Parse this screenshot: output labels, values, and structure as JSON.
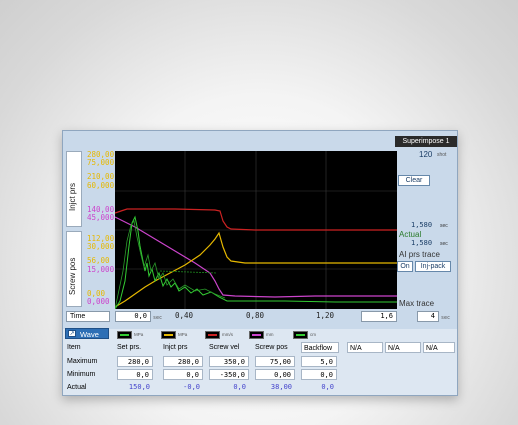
{
  "header": {
    "superimpose_label": "Superimpose 1",
    "shot_count": "120",
    "shot_unit": "shot"
  },
  "left_axes": {
    "upper_label": "Injct prs",
    "lower_label": "Screw pos",
    "upper_ticks": [
      {
        "text": "280,00",
        "color": "#e6b800"
      },
      {
        "text": "75,000",
        "color": "#e6b800"
      },
      {
        "text": "210,00",
        "color": "#e6b800"
      },
      {
        "text": "60,000",
        "color": "#e6b800"
      },
      {
        "text": "140,00",
        "color": "#cc44cc"
      },
      {
        "text": "45,000",
        "color": "#cc44cc"
      }
    ],
    "lower_ticks": [
      {
        "text": "112,00",
        "color": "#e6b800"
      },
      {
        "text": "30,000",
        "color": "#e6b800"
      },
      {
        "text": "56,00",
        "color": "#e6b800"
      },
      {
        "text": "15,000",
        "color": "#cc44cc"
      },
      {
        "text": "0,00",
        "color": "#e6b800"
      },
      {
        "text": "0,000",
        "color": "#cc44cc"
      }
    ]
  },
  "right_panel": {
    "clear_label": "Clear",
    "time1_value": "1,580",
    "time1_unit": "sec",
    "actual_label": "Actual",
    "time2_value": "1,580",
    "time2_unit": "sec",
    "ai_trace_label": "AI prs trace",
    "on_label": "On",
    "mode_label": "Inj-pack",
    "max_trace_label": "Max trace",
    "max_trace_value": "4",
    "max_trace_unit": "sec"
  },
  "time_axis": {
    "label": "Time",
    "start_value": "0,0",
    "unit": "sec",
    "ticks": [
      "0,40",
      "0,80",
      "1,20"
    ],
    "end_value": "1,6"
  },
  "wave_tab": {
    "label": "Wave"
  },
  "legend": [
    {
      "unit": "MPa",
      "color": "#33cc33"
    },
    {
      "unit": "MPa",
      "color": "#e6b800"
    },
    {
      "unit": "mm/s",
      "color": "#cc2222"
    },
    {
      "unit": "mm",
      "color": "#cc44cc"
    },
    {
      "unit": "cm",
      "color": "#33cc33"
    }
  ],
  "table": {
    "headers": [
      "Item",
      "Set prs.",
      "Injct prs",
      "Screw vel",
      "Screw pos",
      "Backflow",
      "N/A",
      "N/A",
      "N/A"
    ],
    "rows": [
      {
        "label": "Maximum",
        "values": [
          "280,0",
          "280,0",
          "350,0",
          "75,00",
          "5,0"
        ]
      },
      {
        "label": "Minimum",
        "values": [
          "0,0",
          "0,0",
          "-350,0",
          "0,00",
          "0,0"
        ]
      },
      {
        "label": "Actual",
        "values": [
          "150,0",
          "-0,0",
          "0,0",
          "38,00",
          "0,0"
        ]
      }
    ]
  }
}
